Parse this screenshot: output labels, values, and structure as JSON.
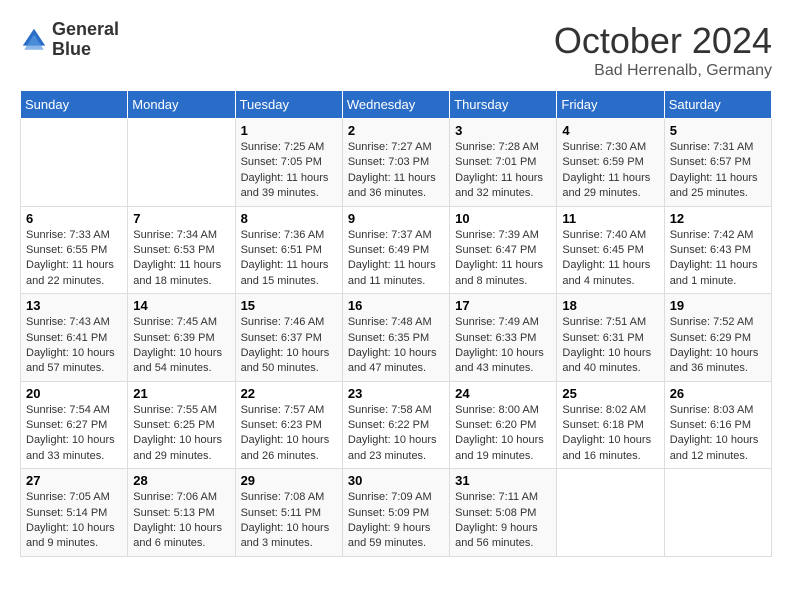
{
  "header": {
    "logo_line1": "General",
    "logo_line2": "Blue",
    "month_title": "October 2024",
    "subtitle": "Bad Herrenalb, Germany"
  },
  "days_of_week": [
    "Sunday",
    "Monday",
    "Tuesday",
    "Wednesday",
    "Thursday",
    "Friday",
    "Saturday"
  ],
  "weeks": [
    [
      {
        "day": "",
        "info": ""
      },
      {
        "day": "",
        "info": ""
      },
      {
        "day": "1",
        "info": "Sunrise: 7:25 AM\nSunset: 7:05 PM\nDaylight: 11 hours\nand 39 minutes."
      },
      {
        "day": "2",
        "info": "Sunrise: 7:27 AM\nSunset: 7:03 PM\nDaylight: 11 hours\nand 36 minutes."
      },
      {
        "day": "3",
        "info": "Sunrise: 7:28 AM\nSunset: 7:01 PM\nDaylight: 11 hours\nand 32 minutes."
      },
      {
        "day": "4",
        "info": "Sunrise: 7:30 AM\nSunset: 6:59 PM\nDaylight: 11 hours\nand 29 minutes."
      },
      {
        "day": "5",
        "info": "Sunrise: 7:31 AM\nSunset: 6:57 PM\nDaylight: 11 hours\nand 25 minutes."
      }
    ],
    [
      {
        "day": "6",
        "info": "Sunrise: 7:33 AM\nSunset: 6:55 PM\nDaylight: 11 hours\nand 22 minutes."
      },
      {
        "day": "7",
        "info": "Sunrise: 7:34 AM\nSunset: 6:53 PM\nDaylight: 11 hours\nand 18 minutes."
      },
      {
        "day": "8",
        "info": "Sunrise: 7:36 AM\nSunset: 6:51 PM\nDaylight: 11 hours\nand 15 minutes."
      },
      {
        "day": "9",
        "info": "Sunrise: 7:37 AM\nSunset: 6:49 PM\nDaylight: 11 hours\nand 11 minutes."
      },
      {
        "day": "10",
        "info": "Sunrise: 7:39 AM\nSunset: 6:47 PM\nDaylight: 11 hours\nand 8 minutes."
      },
      {
        "day": "11",
        "info": "Sunrise: 7:40 AM\nSunset: 6:45 PM\nDaylight: 11 hours\nand 4 minutes."
      },
      {
        "day": "12",
        "info": "Sunrise: 7:42 AM\nSunset: 6:43 PM\nDaylight: 11 hours\nand 1 minute."
      }
    ],
    [
      {
        "day": "13",
        "info": "Sunrise: 7:43 AM\nSunset: 6:41 PM\nDaylight: 10 hours\nand 57 minutes."
      },
      {
        "day": "14",
        "info": "Sunrise: 7:45 AM\nSunset: 6:39 PM\nDaylight: 10 hours\nand 54 minutes."
      },
      {
        "day": "15",
        "info": "Sunrise: 7:46 AM\nSunset: 6:37 PM\nDaylight: 10 hours\nand 50 minutes."
      },
      {
        "day": "16",
        "info": "Sunrise: 7:48 AM\nSunset: 6:35 PM\nDaylight: 10 hours\nand 47 minutes."
      },
      {
        "day": "17",
        "info": "Sunrise: 7:49 AM\nSunset: 6:33 PM\nDaylight: 10 hours\nand 43 minutes."
      },
      {
        "day": "18",
        "info": "Sunrise: 7:51 AM\nSunset: 6:31 PM\nDaylight: 10 hours\nand 40 minutes."
      },
      {
        "day": "19",
        "info": "Sunrise: 7:52 AM\nSunset: 6:29 PM\nDaylight: 10 hours\nand 36 minutes."
      }
    ],
    [
      {
        "day": "20",
        "info": "Sunrise: 7:54 AM\nSunset: 6:27 PM\nDaylight: 10 hours\nand 33 minutes."
      },
      {
        "day": "21",
        "info": "Sunrise: 7:55 AM\nSunset: 6:25 PM\nDaylight: 10 hours\nand 29 minutes."
      },
      {
        "day": "22",
        "info": "Sunrise: 7:57 AM\nSunset: 6:23 PM\nDaylight: 10 hours\nand 26 minutes."
      },
      {
        "day": "23",
        "info": "Sunrise: 7:58 AM\nSunset: 6:22 PM\nDaylight: 10 hours\nand 23 minutes."
      },
      {
        "day": "24",
        "info": "Sunrise: 8:00 AM\nSunset: 6:20 PM\nDaylight: 10 hours\nand 19 minutes."
      },
      {
        "day": "25",
        "info": "Sunrise: 8:02 AM\nSunset: 6:18 PM\nDaylight: 10 hours\nand 16 minutes."
      },
      {
        "day": "26",
        "info": "Sunrise: 8:03 AM\nSunset: 6:16 PM\nDaylight: 10 hours\nand 12 minutes."
      }
    ],
    [
      {
        "day": "27",
        "info": "Sunrise: 7:05 AM\nSunset: 5:14 PM\nDaylight: 10 hours\nand 9 minutes."
      },
      {
        "day": "28",
        "info": "Sunrise: 7:06 AM\nSunset: 5:13 PM\nDaylight: 10 hours\nand 6 minutes."
      },
      {
        "day": "29",
        "info": "Sunrise: 7:08 AM\nSunset: 5:11 PM\nDaylight: 10 hours\nand 3 minutes."
      },
      {
        "day": "30",
        "info": "Sunrise: 7:09 AM\nSunset: 5:09 PM\nDaylight: 9 hours\nand 59 minutes."
      },
      {
        "day": "31",
        "info": "Sunrise: 7:11 AM\nSunset: 5:08 PM\nDaylight: 9 hours\nand 56 minutes."
      },
      {
        "day": "",
        "info": ""
      },
      {
        "day": "",
        "info": ""
      }
    ]
  ]
}
